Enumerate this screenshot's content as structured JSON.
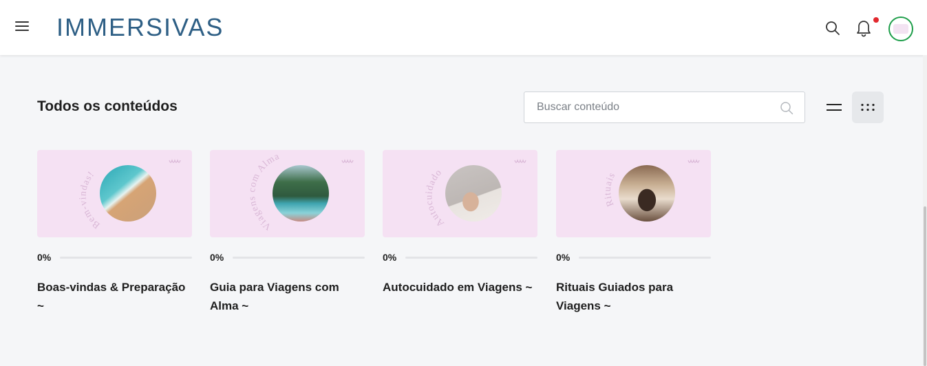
{
  "header": {
    "logo_text": "IMMERSIVAS",
    "notification_dot_color": "#e2282e",
    "avatar_ring_color": "#1e9e4a"
  },
  "main": {
    "title": "Todos os conteúdos",
    "search": {
      "placeholder": "Buscar conteúdo",
      "value": ""
    },
    "view_mode": "grid"
  },
  "cards": [
    {
      "arc_text": "Bem-vindas!",
      "progress_label": "0%",
      "progress": 0,
      "title": "Boas-vindas & Preparação ~",
      "photo": "beach"
    },
    {
      "arc_text": "Viagens com Alma",
      "progress_label": "0%",
      "progress": 0,
      "title": "Guia para Viagens com Alma ~",
      "photo": "mountains"
    },
    {
      "arc_text": "Autocuidado",
      "progress_label": "0%",
      "progress": 0,
      "title": "Autocuidado em Viagens ~",
      "photo": "hand"
    },
    {
      "arc_text": "Rituais",
      "progress_label": "0%",
      "progress": 0,
      "title": "Rituais Guiados para Viagens ~",
      "photo": "ritual"
    }
  ],
  "colors": {
    "card_bg": "#f5e1f3",
    "page_bg": "#f5f6f8",
    "logo": "#2e5f85",
    "progress_fill": "#6b52c8"
  }
}
